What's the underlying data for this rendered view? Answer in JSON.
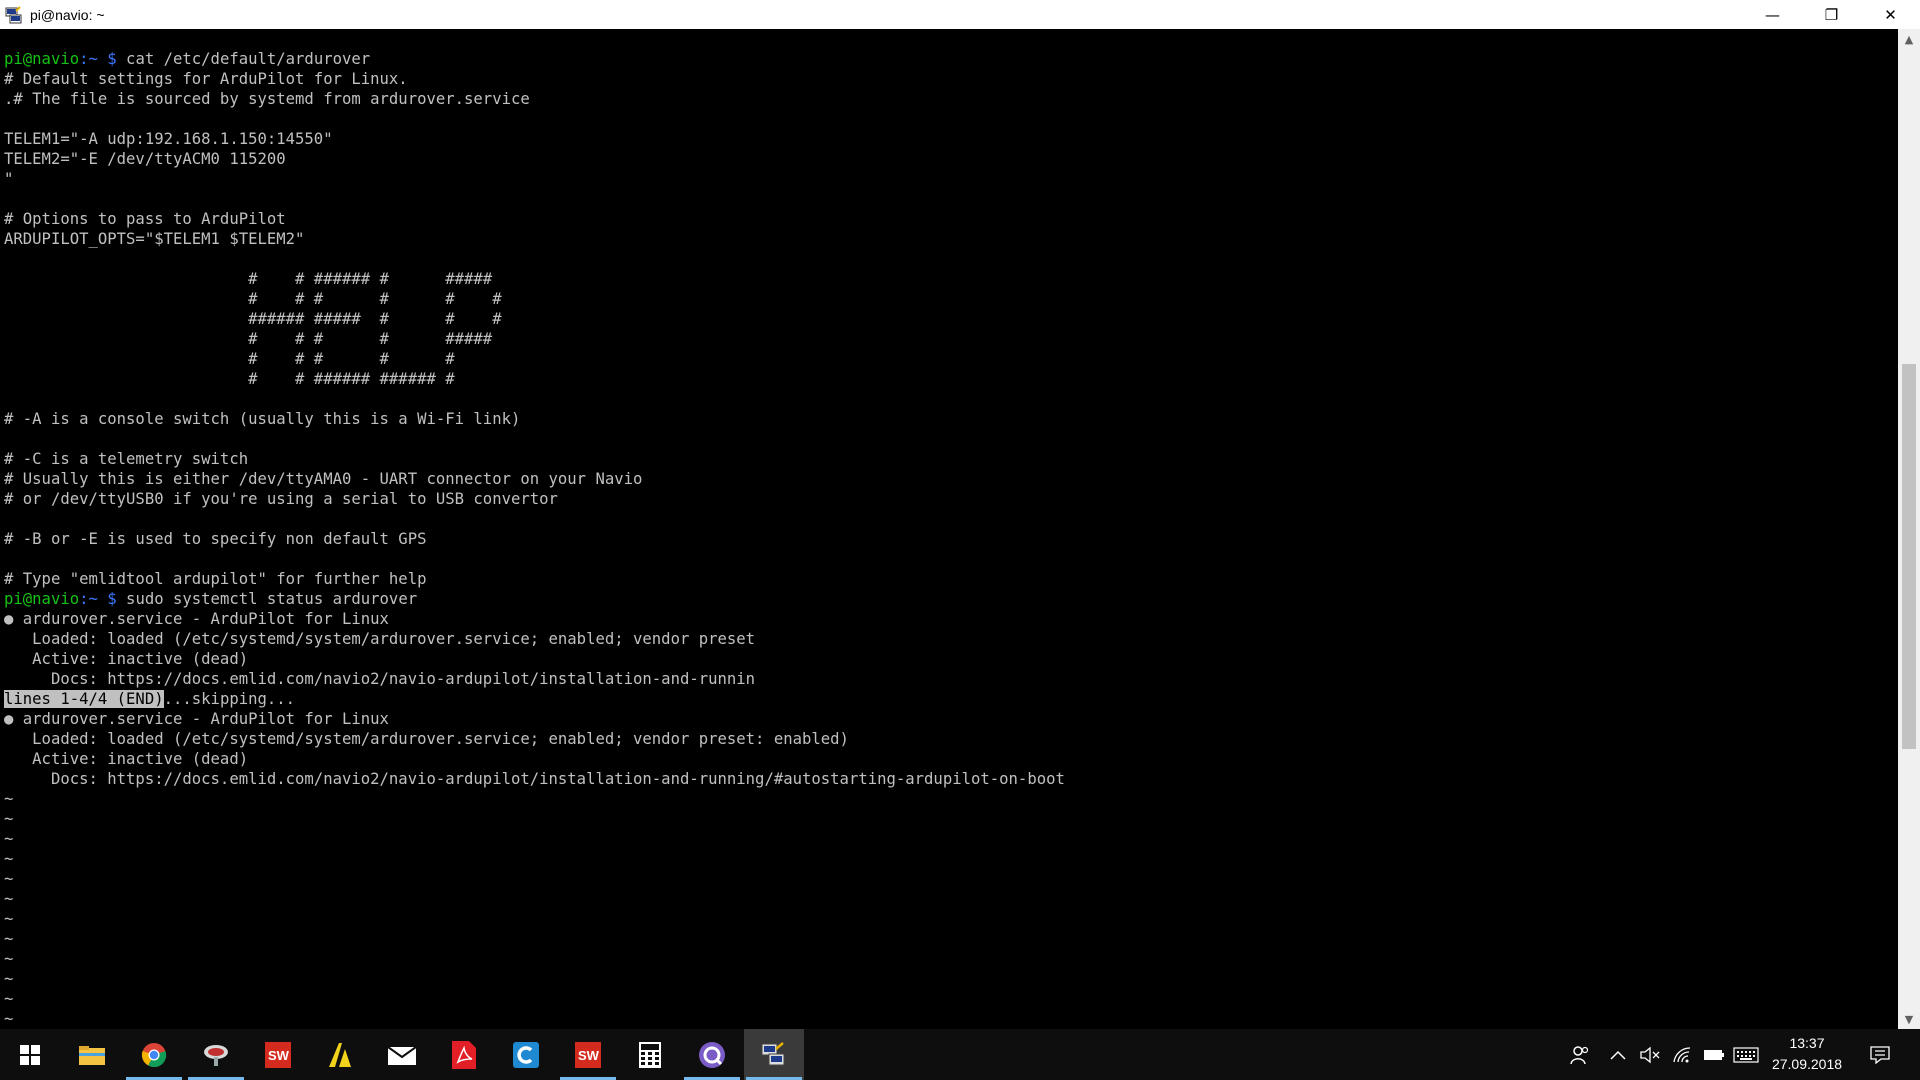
{
  "window": {
    "title": "pi@navio: ~",
    "minimize": "—",
    "restore": "❐",
    "close": "✕"
  },
  "terminal": {
    "lines": [
      {
        "prompt": "pi@navio",
        "sep": ":~ $",
        "cmd": " cat /etc/default/ardurover"
      },
      {
        "text": "# Default settings for ArduPilot for Linux."
      },
      {
        "text": ".# The file is sourced by systemd from ardurover.service"
      },
      {
        "text": ""
      },
      {
        "text": "TELEM1=\"-A udp:192.168.1.150:14550\""
      },
      {
        "text": "TELEM2=\"-E /dev/ttyACM0 115200"
      },
      {
        "text": "\""
      },
      {
        "text": ""
      },
      {
        "text": "# Options to pass to ArduPilot"
      },
      {
        "text": "ARDUPILOT_OPTS=\"$TELEM1 $TELEM2\""
      },
      {
        "text": ""
      },
      {
        "text": "                          #    # ###### #      #####"
      },
      {
        "text": "                          #    # #      #      #    #"
      },
      {
        "text": "                          ###### #####  #      #    #"
      },
      {
        "text": "                          #    # #      #      #####"
      },
      {
        "text": "                          #    # #      #      #"
      },
      {
        "text": "                          #    # ###### ###### #"
      },
      {
        "text": ""
      },
      {
        "text": "# -A is a console switch (usually this is a Wi-Fi link)"
      },
      {
        "text": ""
      },
      {
        "text": "# -C is a telemetry switch"
      },
      {
        "text": "# Usually this is either /dev/ttyAMA0 - UART connector on your Navio"
      },
      {
        "text": "# or /dev/ttyUSB0 if you're using a serial to USB convertor"
      },
      {
        "text": ""
      },
      {
        "text": "# -B or -E is used to specify non default GPS"
      },
      {
        "text": ""
      },
      {
        "text": "# Type \"emlidtool ardupilot\" for further help"
      },
      {
        "prompt": "pi@navio",
        "sep": ":~ $",
        "cmd": " sudo systemctl status ardurover"
      },
      {
        "text": "● ardurover.service - ArduPilot for Linux"
      },
      {
        "text": "   Loaded: loaded (/etc/systemd/system/ardurover.service; enabled; vendor preset"
      },
      {
        "text": "   Active: inactive (dead)"
      },
      {
        "text": "     Docs: https://docs.emlid.com/navio2/navio-ardupilot/installation-and-runnin"
      },
      {
        "hl": "lines 1-4/4 (END)",
        "text": "...skipping..."
      },
      {
        "text": "● ardurover.service - ArduPilot for Linux"
      },
      {
        "text": "   Loaded: loaded (/etc/systemd/system/ardurover.service; enabled; vendor preset: enabled)"
      },
      {
        "text": "   Active: inactive (dead)"
      },
      {
        "text": "     Docs: https://docs.emlid.com/navio2/navio-ardupilot/installation-and-running/#autostarting-ardupilot-on-boot"
      },
      {
        "text": "~"
      },
      {
        "text": "~"
      },
      {
        "text": "~"
      },
      {
        "text": "~"
      },
      {
        "text": "~"
      },
      {
        "text": "~"
      },
      {
        "text": "~"
      },
      {
        "text": "~"
      },
      {
        "text": "~"
      },
      {
        "text": "~"
      },
      {
        "text": "~"
      },
      {
        "text": "~"
      }
    ]
  },
  "taskbar": {
    "apps": [
      {
        "name": "start-button-icon",
        "color": "#ffffff"
      },
      {
        "name": "file-explorer-icon",
        "color": "#f4c342"
      },
      {
        "name": "chrome-icon",
        "color": "#db4437"
      },
      {
        "name": "satellite-dish-icon",
        "color": "#d0d0d0"
      },
      {
        "name": "solidworks-icon",
        "color": "#d52b1e"
      },
      {
        "name": "archicad-icon",
        "color": "#f2d21b"
      },
      {
        "name": "mail-icon",
        "color": "#ffffff"
      },
      {
        "name": "acrobat-icon",
        "color": "#e21f26"
      },
      {
        "name": "c-app-icon",
        "color": "#1f8ad2"
      },
      {
        "name": "solidworks-2016-icon",
        "color": "#d52b1e"
      },
      {
        "name": "calculator-icon",
        "color": "#ffffff"
      },
      {
        "name": "vpn-client-icon",
        "color": "#7b5cc7"
      },
      {
        "name": "putty-icon",
        "color": "#3b6fd8"
      }
    ],
    "clock": {
      "time": "13:37",
      "date": "27.09.2018"
    }
  }
}
